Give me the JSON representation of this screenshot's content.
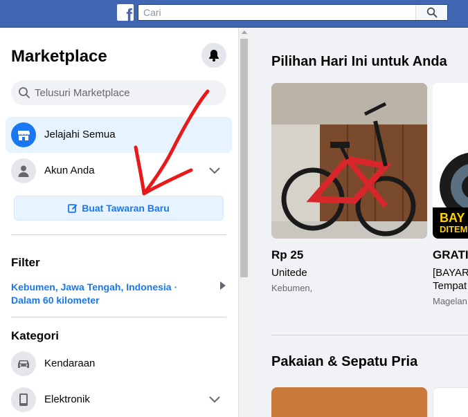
{
  "topbar": {
    "logo": "f",
    "search_placeholder": "Cari"
  },
  "sidebar": {
    "title": "Marketplace",
    "search_placeholder": "Telusuri Marketplace",
    "nav": {
      "browse_all": "Jelajahi Semua",
      "your_account": "Akun Anda"
    },
    "create_button": "Buat Tawaran Baru",
    "filter": {
      "heading": "Filter",
      "location": "Kebumen, Jawa Tengah, Indonesia · Dalam 60 kilometer"
    },
    "categories": {
      "heading": "Kategori",
      "items": [
        {
          "label": "Kendaraan",
          "icon": "car-icon"
        },
        {
          "label": "Elektronik",
          "icon": "phone-icon"
        }
      ]
    }
  },
  "main": {
    "section1_title": "Pilihan Hari Ini untuk Anda",
    "listings": [
      {
        "price": "Rp 25",
        "title": "Unitede",
        "location": "Kebumen,"
      },
      {
        "price": "GRATI",
        "title": "[BAYAR Tempat",
        "location": "Magelan",
        "badge_line1": "BAY",
        "badge_line2": "DITEM"
      }
    ],
    "section2_title": "Pakaian & Sepatu Pria"
  },
  "colors": {
    "topbar": "#4267b2",
    "accent": "#1877f2",
    "annotation": "#e8191a"
  }
}
